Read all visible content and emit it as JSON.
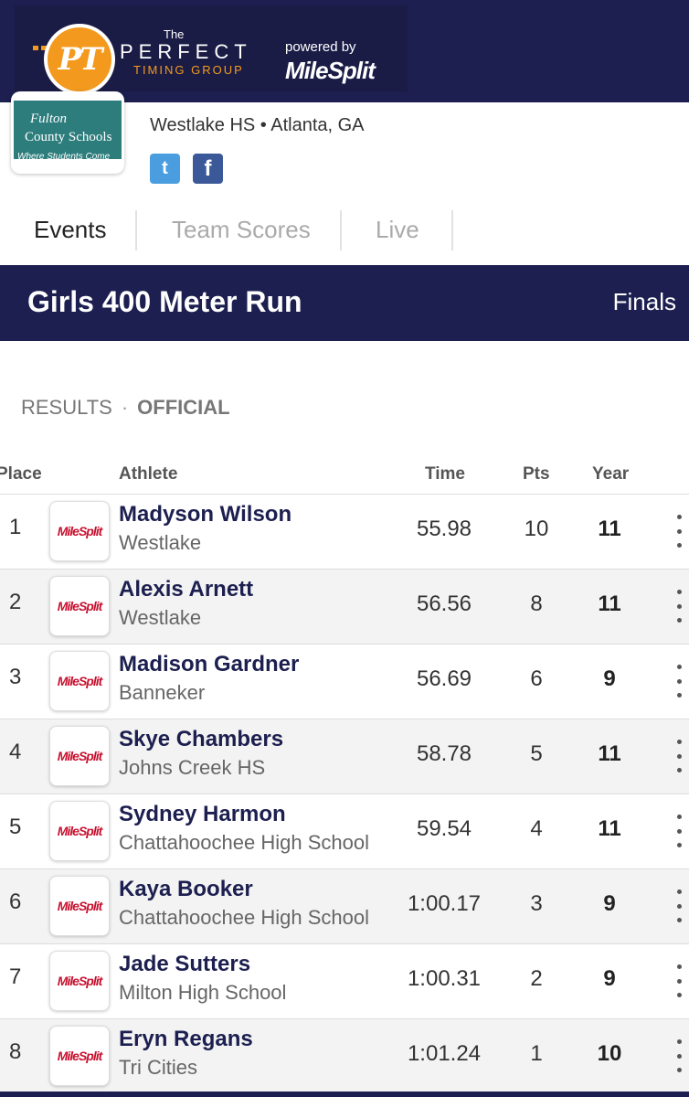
{
  "banner": {
    "logo_initials": "PT",
    "the": "The",
    "perfect": "PERFECT",
    "timing_group": "TIMING GROUP",
    "powered_by": "powered by",
    "milesplit": "MileSplit"
  },
  "meet": {
    "logo_line1": "Fulton",
    "logo_line2": "County Schools",
    "logo_line3": "Where Students Come First",
    "location": "Westlake HS • Atlanta, GA",
    "twitter_glyph": "t",
    "facebook_glyph": "f"
  },
  "tabs": [
    {
      "label": "Events"
    },
    {
      "label": "Team Scores"
    },
    {
      "label": "Live"
    }
  ],
  "event": {
    "title": "Girls 400 Meter Run",
    "round": "Finals"
  },
  "results": {
    "label": "RESULTS",
    "separator": "·",
    "status": "OFFICIAL"
  },
  "table": {
    "headers": {
      "place": "Place",
      "athlete": "Athlete",
      "time": "Time",
      "pts": "Pts",
      "year": "Year"
    },
    "avatar_text": "MileSplit",
    "rows": [
      {
        "place": "1",
        "name": "Madyson Wilson",
        "team": "Westlake",
        "time": "55.98",
        "pts": "10",
        "year": "11"
      },
      {
        "place": "2",
        "name": "Alexis Arnett",
        "team": "Westlake",
        "time": "56.56",
        "pts": "8",
        "year": "11"
      },
      {
        "place": "3",
        "name": "Madison Gardner",
        "team": "Banneker",
        "time": "56.69",
        "pts": "6",
        "year": "9"
      },
      {
        "place": "4",
        "name": "Skye Chambers",
        "team": "Johns Creek HS",
        "time": "58.78",
        "pts": "5",
        "year": "11"
      },
      {
        "place": "5",
        "name": "Sydney Harmon",
        "team": "Chattahoochee High School",
        "time": "59.54",
        "pts": "4",
        "year": "11"
      },
      {
        "place": "6",
        "name": "Kaya Booker",
        "team": "Chattahoochee High School",
        "time": "1:00.17",
        "pts": "3",
        "year": "9"
      },
      {
        "place": "7",
        "name": "Jade Sutters",
        "team": "Milton High School",
        "time": "1:00.31",
        "pts": "2",
        "year": "9"
      },
      {
        "place": "8",
        "name": "Eryn Regans",
        "team": "Tri Cities",
        "time": "1:01.24",
        "pts": "1",
        "year": "10"
      }
    ]
  },
  "colors": {
    "navy": "#1c1f4f",
    "orange": "#f39a1e",
    "milesplit_red": "#c8102e"
  }
}
